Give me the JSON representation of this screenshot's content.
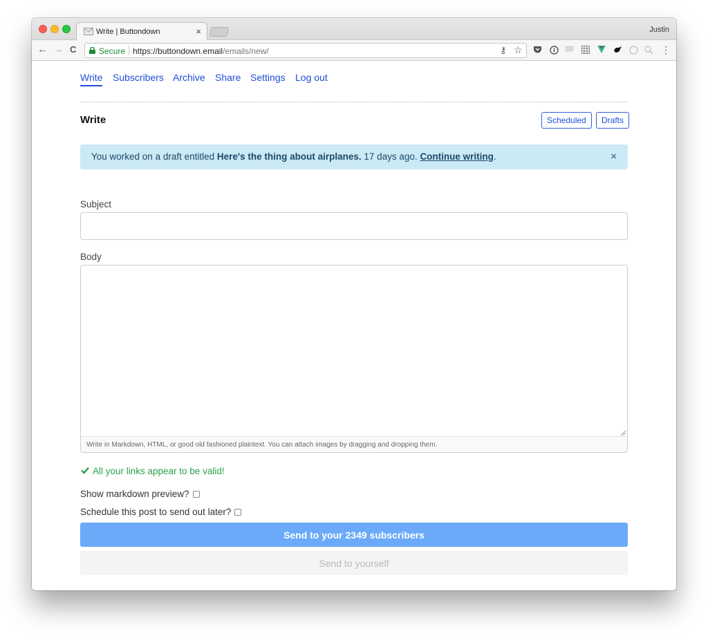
{
  "browser": {
    "tab_title": "Write | Buttondown",
    "tab_close": "×",
    "profile_name": "Justin",
    "security_label": "Secure",
    "url_host": "https://buttondown.email",
    "url_path": "/emails/new/",
    "back_icon": "←",
    "forward_icon": "→",
    "reload_icon": "C",
    "key_icon": "⚷",
    "star_icon": "☆",
    "menu_icon": "⋮"
  },
  "nav": {
    "items": [
      "Write",
      "Subscribers",
      "Archive",
      "Share",
      "Settings",
      "Log out"
    ],
    "active": "Write"
  },
  "header": {
    "title": "Write",
    "scheduled_label": "Scheduled",
    "drafts_label": "Drafts"
  },
  "alert": {
    "prefix": "You worked on a draft entitled ",
    "draft_title": "Here's the thing about airplanes.",
    "middle": " 17 days ago. ",
    "link": "Continue writing",
    "suffix": ".",
    "close": "×"
  },
  "form": {
    "subject_label": "Subject",
    "subject_value": "",
    "body_label": "Body",
    "body_value": "",
    "body_help": "Write in Markdown, HTML, or good old fashioned plaintext. You can attach images by dragging and dropping them.",
    "links_valid": "All your links appear to be valid!",
    "preview_label": "Show markdown preview?",
    "schedule_label": "Schedule this post to send out later?",
    "send_label": "Send to your 2349 subscribers",
    "send_self_label": "Send to yourself"
  },
  "colors": {
    "link": "#1f4dd6",
    "alert_bg": "#cce9f6",
    "valid_green": "#2aa24a",
    "primary_button": "#6aaaf8"
  }
}
